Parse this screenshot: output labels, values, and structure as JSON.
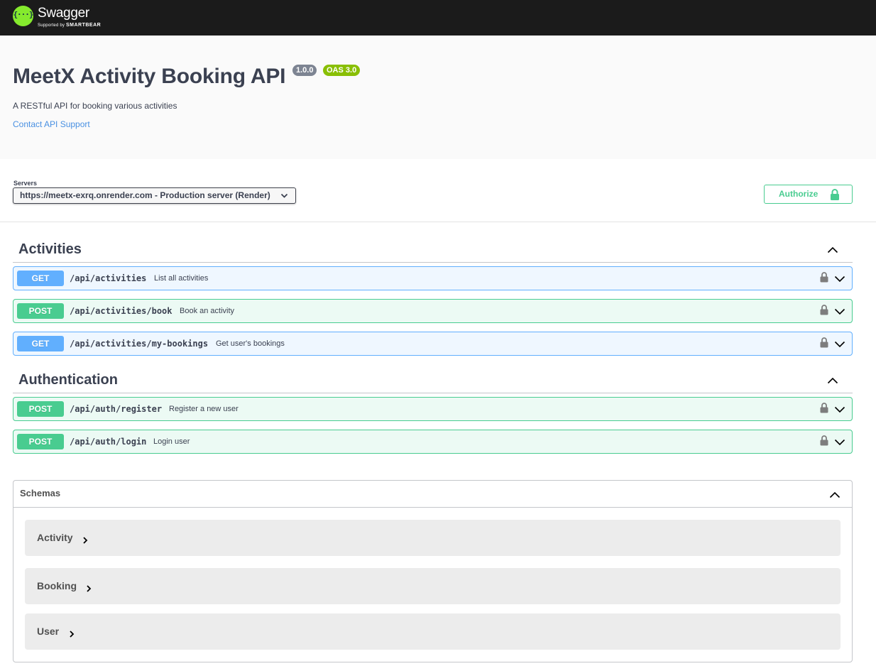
{
  "topbar": {
    "logo_glyph": "{···}",
    "logo_title": "Swagger",
    "logo_sub_prefix": "Supported by ",
    "logo_sub_brand": "SMARTBEAR"
  },
  "info": {
    "title": "MeetX Activity Booking API",
    "version": "1.0.0",
    "oas": "OAS 3.0",
    "description": "A RESTful API for booking various activities",
    "contact": "Contact API Support"
  },
  "servers": {
    "label": "Servers",
    "selected": "https://meetx-exrq.onrender.com - Production server (Render)"
  },
  "authorize": {
    "label": "Authorize"
  },
  "tags": [
    {
      "name": "Activities",
      "operations": [
        {
          "method": "GET",
          "path": "/api/activities",
          "summary": "List all activities"
        },
        {
          "method": "POST",
          "path": "/api/activities/book",
          "summary": "Book an activity"
        },
        {
          "method": "GET",
          "path": "/api/activities/my-bookings",
          "summary": "Get user's bookings"
        }
      ]
    },
    {
      "name": "Authentication",
      "operations": [
        {
          "method": "POST",
          "path": "/api/auth/register",
          "summary": "Register a new user"
        },
        {
          "method": "POST",
          "path": "/api/auth/login",
          "summary": "Login user"
        }
      ]
    }
  ],
  "schemas": {
    "title": "Schemas",
    "models": [
      "Activity",
      "Booking",
      "User"
    ]
  },
  "colors": {
    "get": "#61affe",
    "post": "#49cc90",
    "topbar": "#1b1b1b",
    "logo": "#85ea2d",
    "oas_badge": "#89bf04",
    "version_badge": "#7d8492",
    "link": "#4990e2"
  },
  "icons": [
    "swagger-logo-icon",
    "chevron-down-icon",
    "lock-icon",
    "chevron-up-icon",
    "chevron-right-icon"
  ]
}
